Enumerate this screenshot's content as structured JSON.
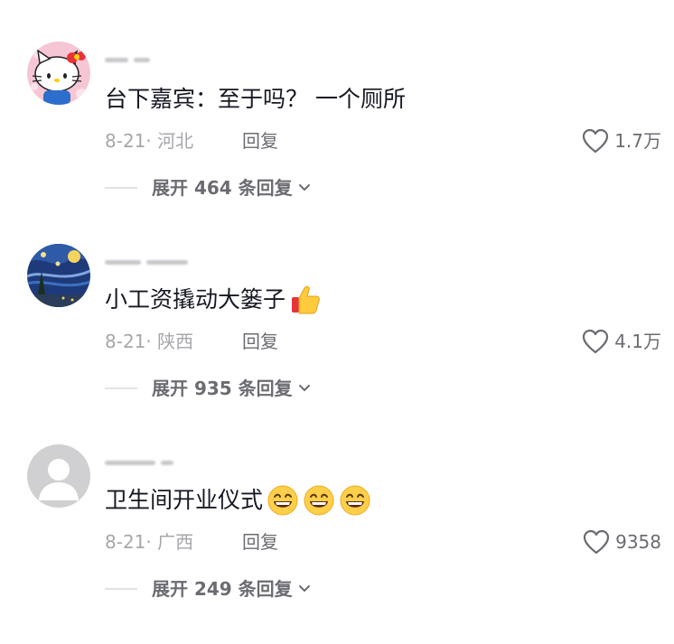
{
  "colors": {
    "text_primary": "#161823",
    "text_meta": "#a6a7ab",
    "text_secondary": "#6b6c72"
  },
  "comments": [
    {
      "avatar_icon": "hello-kitty-avatar",
      "content": "台下嘉宾：至于吗？ 一个厕所",
      "emojis": [],
      "meta": "8-21· 河北",
      "reply_label": "回复",
      "like_icon": "heart-outline-icon",
      "likes": "1.7万",
      "expand_label": "展开 464 条回复"
    },
    {
      "avatar_icon": "starry-night-avatar",
      "content": "小工资撬动大篓子",
      "emojis": [
        "thumbs-up-emoji"
      ],
      "meta": "8-21· 陕西",
      "reply_label": "回复",
      "like_icon": "heart-outline-icon",
      "likes": "4.1万",
      "expand_label": "展开 935 条回复"
    },
    {
      "avatar_icon": "default-user-avatar",
      "content": "卫生间开业仪式",
      "emojis": [
        "grinning-face-emoji",
        "grinning-face-emoji",
        "grinning-face-emoji"
      ],
      "meta": "8-21· 广西",
      "reply_label": "回复",
      "like_icon": "heart-outline-icon",
      "likes": "9358",
      "expand_label": "展开 249 条回复"
    }
  ]
}
